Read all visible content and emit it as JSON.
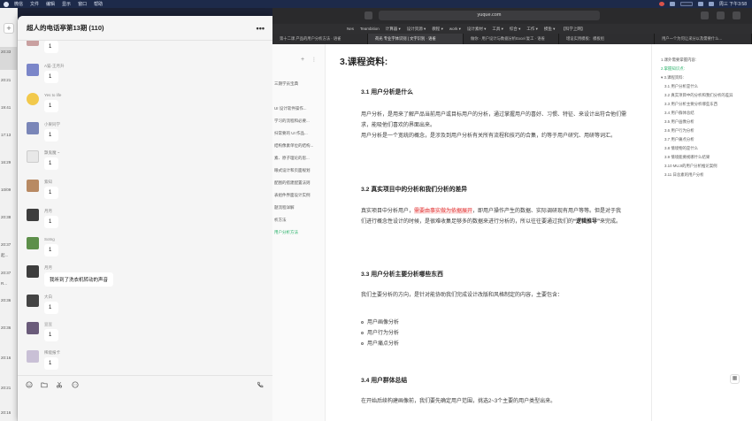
{
  "menubar": {
    "items": [
      "微信",
      "文件",
      "编辑",
      "显示",
      "窗口",
      "帮助"
    ],
    "clock": "周三 下午3:58"
  },
  "leftstrip": {
    "times": [
      "20:33",
      "20:21",
      "19:41",
      "17:13",
      "16:29",
      "10/09",
      "20:38",
      "20:37",
      "20:37",
      "20:36",
      "20:36",
      "20:16",
      "20:21",
      "20:16"
    ],
    "snippets": [
      "起...",
      "R..."
    ]
  },
  "chat": {
    "title": "超人的电话亭第13期 (110)",
    "more_label": "•••",
    "messages": [
      {
        "name": "",
        "text": "1",
        "avatar": "#c9a0a0"
      },
      {
        "name": "A猫-王月升",
        "text": "1",
        "avatar": "#7b86c9"
      },
      {
        "name": "Yes to life",
        "text": "1",
        "avatar": "#f2c94c"
      },
      {
        "name": "小果同学",
        "text": "1",
        "avatar": "#7a86b8"
      },
      {
        "name": "飘鬼魔 ~",
        "text": "1",
        "avatar": "#e8e8e8"
      },
      {
        "name": "紫知",
        "text": "1",
        "avatar": "#b88a63"
      },
      {
        "name": "月月",
        "text": "1",
        "avatar": "#3d3d3d"
      },
      {
        "name": "Sotng",
        "text": "1",
        "avatar": "#5d8f4a"
      },
      {
        "name": "月月",
        "text": "我听到了洗衣机转动的声音",
        "avatar": "#3d3d3d"
      },
      {
        "name": "大白",
        "text": "1",
        "avatar": "#444444"
      },
      {
        "name": "豆豆",
        "text": "1",
        "avatar": "#6a5b7a"
      },
      {
        "name": "稀能报卡",
        "text": "1",
        "avatar": "#c9c0d6"
      }
    ],
    "toolbar_icons": [
      "emoji-icon",
      "folder-icon",
      "scissors-icon",
      "chat-bubble-icon",
      "phone-icon"
    ]
  },
  "browser": {
    "url": "yuque.com",
    "bookmarks": [
      "Nes",
      "Teambition",
      "计算器 ▾",
      "设计资源 ▾",
      "教程 ▾",
      "work ▾",
      "设计素材 ▾",
      "工具 ▾",
      "综合 ▾",
      "工作 ▾",
      "摸鱼 ▾",
      "【科学上网】"
    ],
    "tabs": [
      {
        "label": "第十二课 产品的用户分析方法 · 语雀",
        "active": false
      },
      {
        "label": "荷光 专业字体识别 | 文字识别 · 语雀",
        "active": true
      },
      {
        "label": "做你 · 用户设计与数据分析Excel 复工 · 语雀",
        "active": false
      },
      {
        "label": "增设实用模板：模板组",
        "active": false
      },
      {
        "label": "用户一个为何让采分以及需要什么...",
        "active": false
      }
    ]
  },
  "docnav": {
    "items": [
      {
        "label": "三期学员宝典",
        "active": false
      },
      {
        "label": "UI 设计软件操作...",
        "active": false
      },
      {
        "label": "学习的流程和必要...",
        "active": false
      },
      {
        "label": "扫常要的 UI 作品...",
        "active": false
      },
      {
        "label": "结构像素单位的结构...",
        "active": false
      },
      {
        "label": "素、原子理论的思...",
        "active": false
      },
      {
        "label": "眼式设计和页面规划",
        "active": false
      },
      {
        "label": "配图的搭建配置法则",
        "active": false
      },
      {
        "label": "表组件界面设计实例",
        "active": false
      },
      {
        "label": "题流程详解",
        "active": false
      },
      {
        "label": "析方法",
        "active": false
      },
      {
        "label": "用户分析方法",
        "active": true
      }
    ]
  },
  "doc": {
    "h2": "3.课程资料:",
    "s1_title": "3.1 用户分析是什么",
    "s1_p1": "用户分析，是用来了解产品当前用户或目标用户的分析，通过掌握用户的喜好、习惯、特征、来设计出符合他们需求，能吸他们喜欢的界面出来。",
    "s1_p2": "用户分析是一个宽统的概念，是涉及到用户分析有关所有流程和技巧的合集，约等于用户研究、用研等词汇。",
    "s2_title": "3.2 真实项目中的分析和我们分析的差异",
    "s2_pre": "真实项目中分析用户，",
    "s2_hl": "需要由事实做为依据展开",
    "s2_post": "，即用户操作产生的数据、实际调研现有用户等等。但是对于我们进行概念性设计的时候，是很难收集足够多的数据来进行分析的，所以往往要通过我们的",
    "s2_strong": "“逻辑推导”",
    "s2_end": "来完成。",
    "s3_title": "3.3 用户分析主要分析哪些东西",
    "s3_p": "我们主要分析的方向，是针对能协助我们完成设计改版和风格制定的内容，主要包含：",
    "s3_list": [
      "用户画像分析",
      "用户行为分析",
      "用户痛点分析"
    ],
    "s4_title": "3.4 用户群体总结",
    "s4_p": "在开始后续构建画像前，我们要先确定用户范围，挑选2~3个主要的用户类型出来。"
  },
  "toc": {
    "items": [
      {
        "label": "1.课外需要掌握内容:",
        "level": 1,
        "active": false
      },
      {
        "label": "2.掌握知识点:",
        "level": 1,
        "active": true
      },
      {
        "label": "3.课程资料:",
        "level": 1,
        "active": false
      },
      {
        "label": "3.1 用户分析是什么",
        "level": 2,
        "active": false
      },
      {
        "label": "3.2 真实项目中的分析和我们分析的差异",
        "level": 2,
        "active": false
      },
      {
        "label": "3.3 用户分析主要分析哪些东西",
        "level": 2,
        "active": false
      },
      {
        "label": "3.4 用户群体总结",
        "level": 2,
        "active": false
      },
      {
        "label": "3.5 用户画像分析",
        "level": 2,
        "active": false
      },
      {
        "label": "3.6 用户行为分析",
        "level": 2,
        "active": false
      },
      {
        "label": "3.7 用户痛点分析",
        "level": 2,
        "active": false
      },
      {
        "label": "3.8 情境物的是什么",
        "level": 2,
        "active": false
      },
      {
        "label": "3.9 情境能要视哪什么结果",
        "level": 2,
        "active": false
      },
      {
        "label": "3.10 MUJI的用户分析推论案例",
        "level": 2,
        "active": false
      },
      {
        "label": "3.11 日总素的用户分析",
        "level": 2,
        "active": false
      }
    ]
  }
}
